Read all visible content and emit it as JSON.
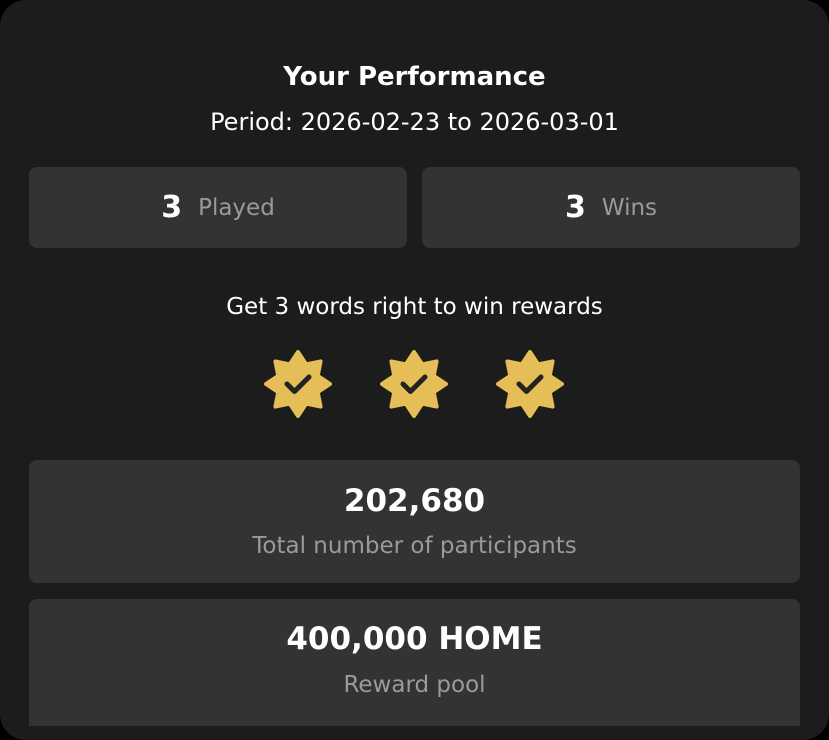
{
  "header": {
    "title": "Your Performance",
    "period": "Period: 2026-02-23 to 2026-03-01"
  },
  "stats": {
    "played": {
      "value": "3",
      "label": "Played"
    },
    "wins": {
      "value": "3",
      "label": "Wins"
    }
  },
  "rule": {
    "text": "Get 3 words right to win rewards"
  },
  "badges": {
    "count": 3,
    "icon": "verified-check-badge-icon",
    "color": "#E6BE57",
    "check_color": "#222222"
  },
  "participants": {
    "value": "202,680",
    "label": "Total number of participants"
  },
  "reward_pool": {
    "value": "400,000 HOME",
    "label": "Reward pool"
  },
  "colors": {
    "background": "#1C1C1C",
    "panel": "#333333",
    "text_primary": "#FFFFFF",
    "text_secondary": "#9A9A9A",
    "accent": "#E6BE57"
  }
}
